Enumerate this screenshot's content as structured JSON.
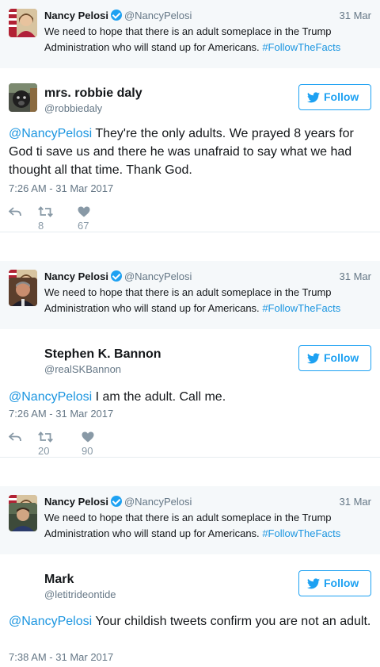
{
  "threads": [
    {
      "quoted": {
        "name": "Nancy Pelosi",
        "handle": "@NancyPelosi",
        "date": "31 Mar",
        "text": "We need to hope that there is an adult someplace in the Trump Administration who will stand up for Americans.",
        "hashtag": "#FollowTheFacts"
      },
      "reply": {
        "name": "mrs. robbie daly",
        "handle": "@robbiedaly",
        "follow_label": "Follow",
        "mention": "@NancyPelosi",
        "text": " They're the only adults. We prayed 8 years for God ti save us and there he was unafraid to say what we had thought all that time. Thank God.",
        "timestamp": "7:26 AM - 31 Mar 2017",
        "retweets": "8",
        "likes": "67"
      }
    },
    {
      "quoted": {
        "name": "Nancy Pelosi",
        "handle": "@NancyPelosi",
        "date": "31 Mar",
        "text": "We need to hope that there is an adult someplace in the Trump Administration who will stand up for Americans.",
        "hashtag": "#FollowTheFacts"
      },
      "reply": {
        "name": "Stephen K. Bannon",
        "handle": "@realSKBannon",
        "follow_label": "Follow",
        "mention": "@NancyPelosi",
        "text": " I am the adult. Call me.",
        "timestamp": "7:26 AM - 31 Mar 2017",
        "retweets": "20",
        "likes": "90"
      }
    },
    {
      "quoted": {
        "name": "Nancy Pelosi",
        "handle": "@NancyPelosi",
        "date": "31 Mar",
        "text": "We need to hope that there is an adult someplace in the Trump Administration who will stand up for Americans.",
        "hashtag": "#FollowTheFacts"
      },
      "reply": {
        "name": "Mark",
        "handle": "@letitrideontide",
        "follow_label": "Follow",
        "mention": "@NancyPelosi",
        "text": " Your childish tweets confirm you are not an adult.",
        "timestamp": "7:38 AM - 31 Mar 2017"
      }
    }
  ],
  "colors": {
    "accent": "#1da1f2",
    "link": "#1b95e0",
    "muted": "#657786",
    "quoted_bg": "#f5f8fa"
  }
}
